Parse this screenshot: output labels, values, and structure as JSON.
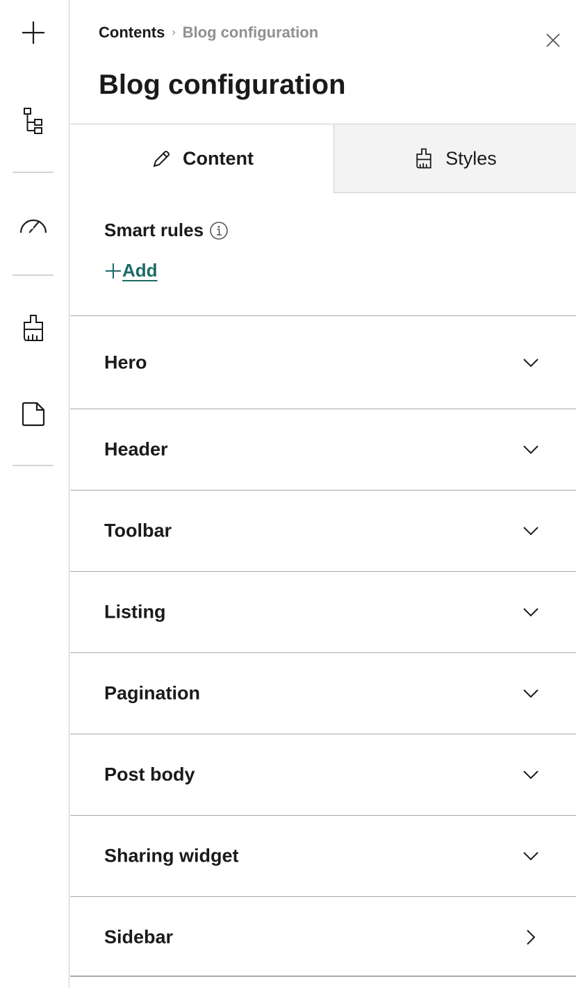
{
  "rail": {
    "items": [
      {
        "icon": "plus-icon"
      },
      {
        "icon": "tree-structure-icon"
      },
      {
        "icon": "performance-gauge-icon"
      },
      {
        "icon": "brush-icon"
      },
      {
        "icon": "page-icon"
      }
    ]
  },
  "breadcrumb": {
    "root": "Contents",
    "separator": "›",
    "current": "Blog configuration"
  },
  "title": "Blog configuration",
  "tabs": [
    {
      "label": "Content",
      "icon": "pencil-icon",
      "active": true
    },
    {
      "label": "Styles",
      "icon": "brush-icon",
      "active": false
    }
  ],
  "smart_rules": {
    "label": "Smart rules",
    "add_label": "Add"
  },
  "sections": [
    {
      "label": "Hero",
      "icon": "chevron-down-icon"
    },
    {
      "label": "Header",
      "icon": "chevron-down-icon"
    },
    {
      "label": "Toolbar",
      "icon": "chevron-down-icon"
    },
    {
      "label": "Listing",
      "icon": "chevron-down-icon"
    },
    {
      "label": "Pagination",
      "icon": "chevron-down-icon"
    },
    {
      "label": "Post body",
      "icon": "chevron-down-icon"
    },
    {
      "label": "Sharing widget",
      "icon": "chevron-down-icon"
    },
    {
      "label": "Sidebar",
      "icon": "chevron-right-icon"
    }
  ],
  "colors": {
    "accent": "#1a6b66",
    "border": "#a8a8a8",
    "inactive_tab_bg": "#f3f3f3"
  }
}
